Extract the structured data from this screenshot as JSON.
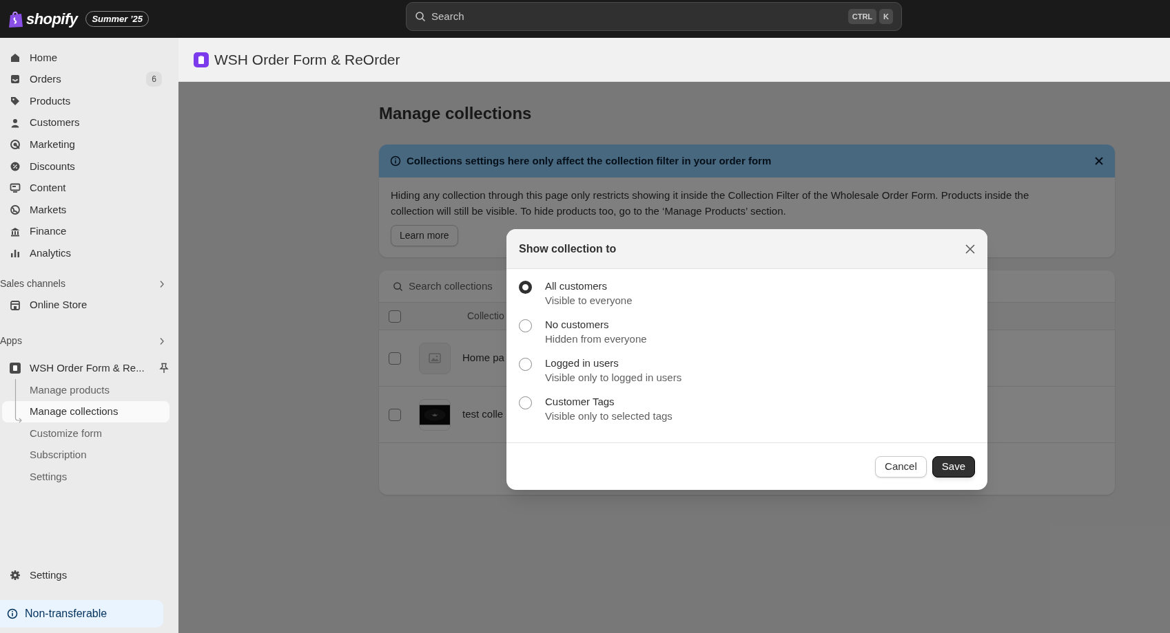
{
  "topbar": {
    "logo": "shopify",
    "edition_badge": "Summer ’25",
    "search": {
      "placeholder": "Search"
    },
    "shortcut_keys": [
      "CTRL",
      "K"
    ]
  },
  "sidebar": {
    "items": [
      {
        "label": "Home",
        "kind": "home"
      },
      {
        "label": "Orders",
        "kind": "orders",
        "badge": "6"
      },
      {
        "label": "Products",
        "kind": "tag"
      },
      {
        "label": "Customers",
        "kind": "person"
      },
      {
        "label": "Marketing",
        "kind": "target"
      },
      {
        "label": "Discounts",
        "kind": "discount"
      },
      {
        "label": "Content",
        "kind": "content"
      },
      {
        "label": "Markets",
        "kind": "globe"
      },
      {
        "label": "Finance",
        "kind": "bank"
      },
      {
        "label": "Analytics",
        "kind": "chart"
      }
    ],
    "sales_channels": {
      "heading": "Sales channels",
      "items": [
        {
          "label": "Online Store",
          "kind": "store"
        }
      ]
    },
    "apps": {
      "heading": "Apps",
      "app": {
        "label": "WSH Order Form & Re...",
        "pinned": true,
        "children": [
          {
            "label": "Manage products",
            "selected": false
          },
          {
            "label": "Manage collections",
            "selected": true
          },
          {
            "label": "Customize form",
            "selected": false
          },
          {
            "label": "Subscription",
            "selected": false
          },
          {
            "label": "Settings",
            "selected": false
          }
        ]
      }
    },
    "settings": {
      "label": "Settings"
    },
    "notice": {
      "label": "Non-transferable"
    }
  },
  "app_header": {
    "title": "WSH Order Form & ReOrder"
  },
  "page": {
    "title": "Manage collections",
    "banner": {
      "title": "Collections settings here only affect the collection filter in your order form",
      "body": "Hiding any collection through this page only restricts showing it inside the Collection Filter of the Wholesale Order Form. Products inside the collection will still be visible. To hide products too, go to the ‘Manage Products’ section.",
      "button": "Learn more"
    },
    "collections": {
      "search": {
        "placeholder": "Search collections"
      },
      "column_header": "Collectio",
      "select_all_checked": false,
      "rows": [
        {
          "title": "Home pa",
          "kind": "placeholder",
          "checked": false
        },
        {
          "title": "test colle",
          "kind": "picture",
          "checked": false
        }
      ]
    }
  },
  "modal": {
    "title": "Show collection to",
    "options": [
      {
        "label": "All customers",
        "description": "Visible to everyone",
        "selected": true
      },
      {
        "label": "No customers",
        "description": "Hidden from everyone",
        "selected": false
      },
      {
        "label": "Logged in users",
        "description": "Visible only to logged in users",
        "selected": false
      },
      {
        "label": "Customer Tags",
        "description": "Visible only to selected tags",
        "selected": false
      }
    ],
    "buttons": [
      {
        "label": "Cancel",
        "kind": "secondary"
      },
      {
        "label": "Save",
        "kind": "primary"
      }
    ]
  }
}
